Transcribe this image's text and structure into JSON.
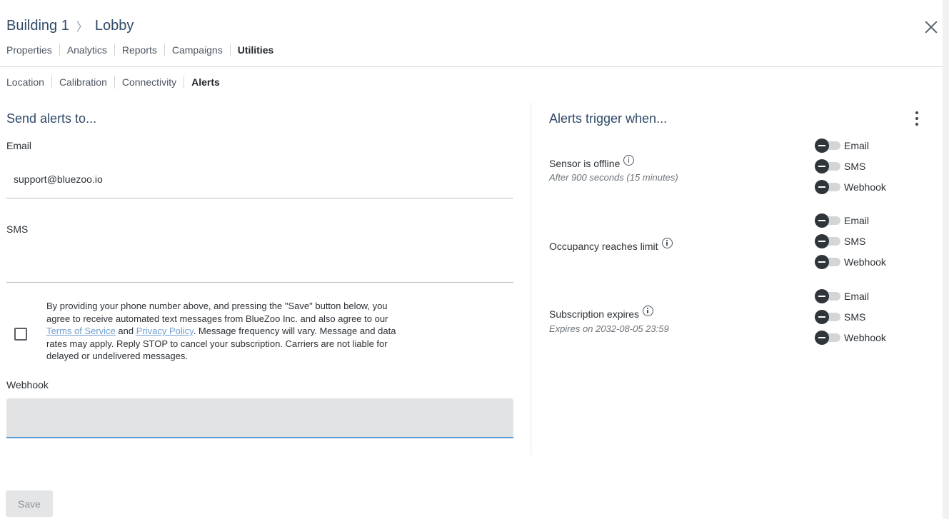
{
  "header": {
    "breadcrumb": {
      "building": "Building 1",
      "separator": "〉",
      "location": "Lobby"
    },
    "tabs": [
      {
        "label": "Properties"
      },
      {
        "label": "Analytics"
      },
      {
        "label": "Reports"
      },
      {
        "label": "Campaigns"
      },
      {
        "label": "Utilities",
        "active": true
      }
    ]
  },
  "subtabs": [
    {
      "label": "Location"
    },
    {
      "label": "Calibration"
    },
    {
      "label": "Connectivity"
    },
    {
      "label": "Alerts",
      "active": true
    }
  ],
  "send_alerts": {
    "title": "Send alerts to...",
    "email": {
      "label": "Email",
      "value": "support@bluezoo.io"
    },
    "sms": {
      "label": "SMS",
      "value": ""
    },
    "consent": {
      "checked": false,
      "text_1": "By providing your phone number above, and pressing the \"Save\" button below, you agree to receive automated text messages from BlueZoo Inc. and also agree to our ",
      "terms_link": "Terms of Service",
      "text_2": " and ",
      "privacy_link": "Privacy Policy",
      "text_3": ". Message frequency will vary. Message and data rates may apply. Reply STOP to cancel your subscription. Carriers are not liable for delayed or undelivered messages."
    },
    "webhook": {
      "label": "Webhook",
      "value": ""
    }
  },
  "alerts_trigger": {
    "title": "Alerts trigger when...",
    "triggers": [
      {
        "name": "Sensor is offline",
        "subtitle": "After 900 seconds (15 minutes)",
        "channels": [
          {
            "label": "Email",
            "on": false
          },
          {
            "label": "SMS",
            "on": false
          },
          {
            "label": "Webhook",
            "on": false
          }
        ]
      },
      {
        "name": "Occupancy reaches limit",
        "subtitle": "",
        "channels": [
          {
            "label": "Email",
            "on": false
          },
          {
            "label": "SMS",
            "on": false
          },
          {
            "label": "Webhook",
            "on": false
          }
        ]
      },
      {
        "name": "Subscription expires",
        "subtitle": "Expires on 2032-08-05 23:59",
        "channels": [
          {
            "label": "Email",
            "on": false
          },
          {
            "label": "SMS",
            "on": false
          },
          {
            "label": "Webhook",
            "on": false
          }
        ]
      }
    ]
  },
  "footer": {
    "save_label": "Save"
  },
  "icons": {
    "close": "close-icon",
    "more": "more-vertical-icon",
    "info": "info-circle-icon",
    "toggle": "toggle-off-icon",
    "checkbox": "checkbox-unchecked-icon"
  },
  "colors": {
    "heading": "#2f4a66",
    "link": "#6f9fd1",
    "input_focus_underline": "#5b9ad8",
    "toggle_knob": "#2f353a",
    "toggle_track": "#d3d5d7",
    "save_button_bg": "#e4e5e6"
  }
}
